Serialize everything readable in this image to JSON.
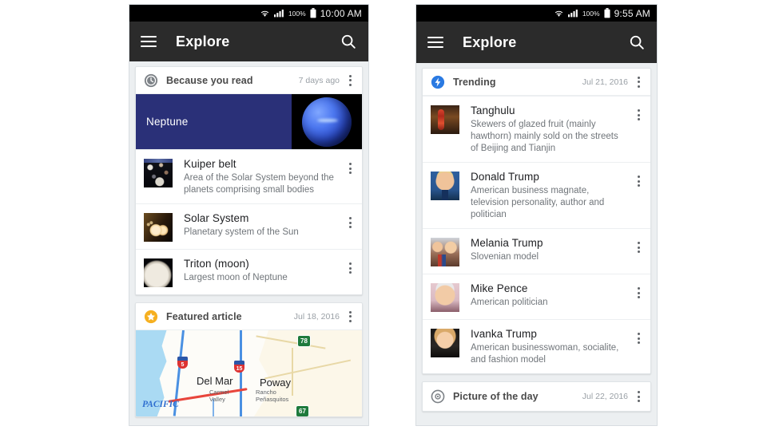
{
  "phones": [
    {
      "id": "left",
      "status_bar": {
        "wifi_icon": "wifi-icon",
        "signal_icon": "cellular-signal-icon",
        "battery_percent": "100%",
        "battery_icon": "battery-full-icon",
        "clock": "10:00 AM"
      },
      "app_bar": {
        "menu_icon": "hamburger-menu-icon",
        "title": "Explore",
        "search_icon": "search-icon"
      },
      "cards": [
        {
          "type": "because-you-read",
          "header": {
            "icon": "history-clock-icon",
            "title": "Because you read",
            "date": "7 days ago",
            "overflow_icon": "more-vert-icon"
          },
          "banner": {
            "title": "Neptune",
            "bg_color": "#2a3078",
            "image": "neptune-planet-image"
          },
          "rows": [
            {
              "thumb": "kuiper-belt-thumbnail",
              "title": "Kuiper belt",
              "desc": "Area of the Solar System beyond the planets comprising small bodies"
            },
            {
              "thumb": "solar-system-thumbnail",
              "title": "Solar System",
              "desc": "Planetary system of the Sun"
            },
            {
              "thumb": "triton-moon-thumbnail",
              "title": "Triton (moon)",
              "desc": "Largest moon of Neptune"
            }
          ]
        },
        {
          "type": "featured-article",
          "header": {
            "icon": "star-badge-icon",
            "title": "Featured article",
            "date": "Jul 18, 2016",
            "overflow_icon": "more-vert-icon"
          },
          "map": {
            "ocean_label": "PACIFIC",
            "labels": [
              "Del Mar",
              "Poway"
            ],
            "small_labels": [
              "Carmel Valley",
              "Rancho Peñasquitos"
            ],
            "route_shields": [
              "5",
              "15"
            ],
            "state_routes": [
              "78",
              "67"
            ]
          }
        }
      ]
    },
    {
      "id": "right",
      "status_bar": {
        "wifi_icon": "wifi-icon",
        "signal_icon": "cellular-signal-icon",
        "battery_percent": "100%",
        "battery_icon": "battery-full-icon",
        "clock": "9:55 AM"
      },
      "app_bar": {
        "menu_icon": "hamburger-menu-icon",
        "title": "Explore",
        "search_icon": "search-icon"
      },
      "cards": [
        {
          "type": "trending",
          "header": {
            "icon": "trending-bolt-icon",
            "title": "Trending",
            "date": "Jul 21, 2016",
            "overflow_icon": "more-vert-icon"
          },
          "rows": [
            {
              "thumb": "tanghulu-thumbnail",
              "title": "Tanghulu",
              "desc": "Skewers of glazed fruit (mainly hawthorn) mainly sold on the streets of Beijing and Tianjin"
            },
            {
              "thumb": "donald-trump-thumbnail",
              "title": "Donald Trump",
              "desc": "American business magnate, television personality, author and politician"
            },
            {
              "thumb": "melania-trump-thumbnail",
              "title": "Melania Trump",
              "desc": "Slovenian model"
            },
            {
              "thumb": "mike-pence-thumbnail",
              "title": "Mike Pence",
              "desc": "American politician"
            },
            {
              "thumb": "ivanka-trump-thumbnail",
              "title": "Ivanka Trump",
              "desc": "American businesswoman, socialite, and fashion model"
            }
          ]
        },
        {
          "type": "picture-of-the-day",
          "header": {
            "icon": "camera-aperture-icon",
            "title": "Picture of the day",
            "date": "Jul 22, 2016",
            "overflow_icon": "more-vert-icon"
          }
        }
      ]
    }
  ],
  "colors": {
    "status_bar": "#000000",
    "app_bar": "#2b2b2b",
    "page_bg": "#eceff1",
    "card_bg": "#ffffff",
    "banner": "#2a3078",
    "trending_accent": "#2a7ae2",
    "featured_accent": "#f6b020",
    "title_text": "#202124",
    "desc_text": "#70757a",
    "date_text": "#9aa0a6"
  }
}
